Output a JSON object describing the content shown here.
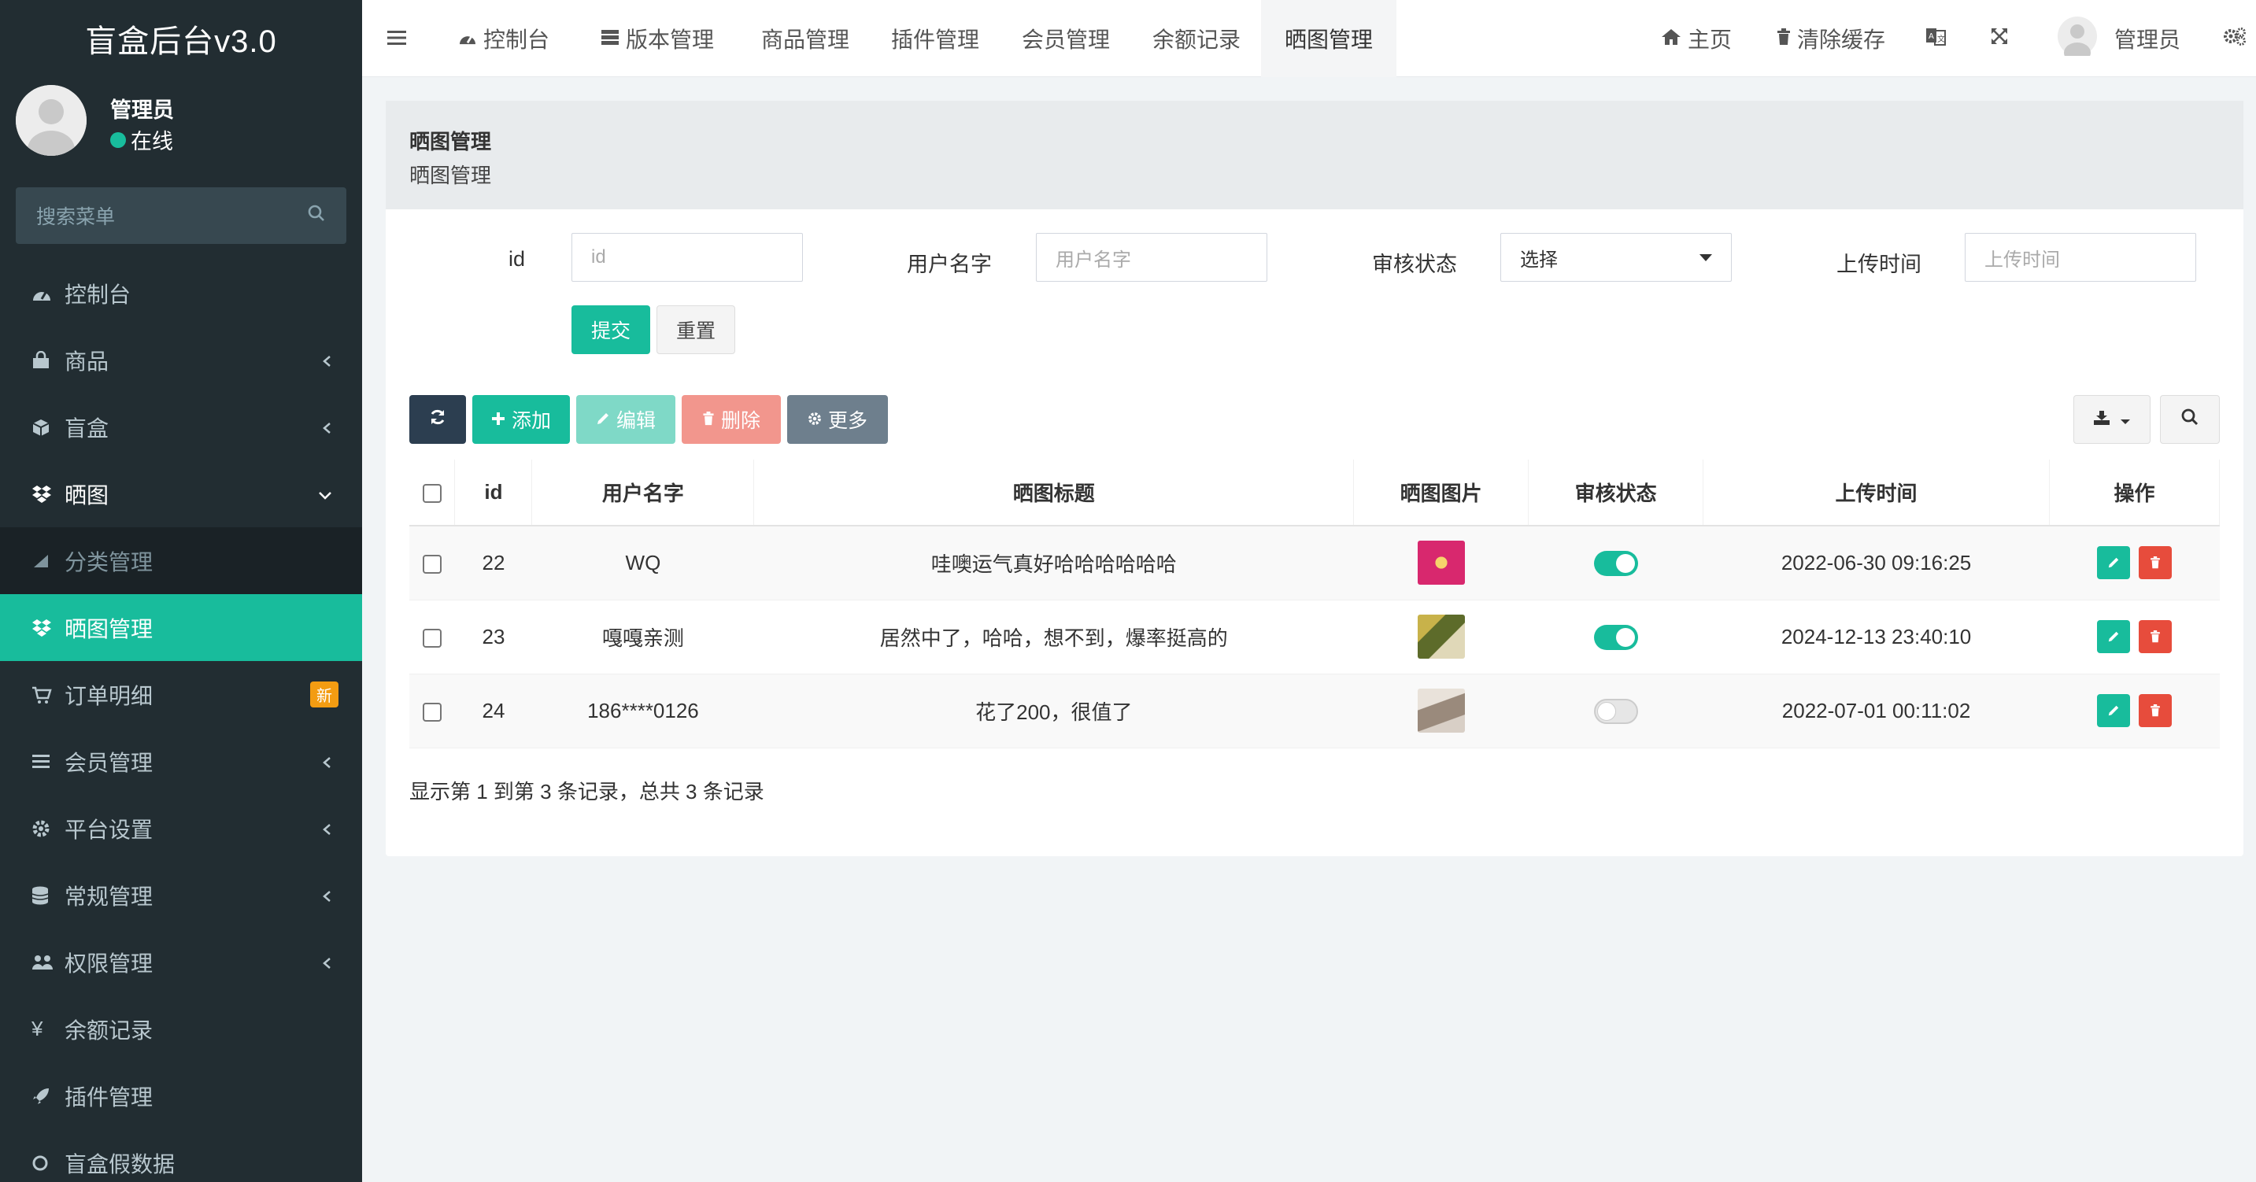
{
  "app": {
    "brand": "盲盒后台v3.0",
    "accent": "#18bc9c",
    "sidebar_bg": "#222d32"
  },
  "user": {
    "name": "管理员",
    "status": "在线"
  },
  "sidebar": {
    "search_placeholder": "搜索菜单",
    "items": [
      {
        "label": "控制台",
        "icon": "dashboard-icon"
      },
      {
        "label": "商品",
        "icon": "shopping-bag-icon"
      },
      {
        "label": "盲盒",
        "icon": "box-icon"
      },
      {
        "label": "晒图",
        "icon": "dropbox-icon"
      },
      {
        "label": "分类管理",
        "icon": "circle-icon"
      },
      {
        "label": "晒图管理",
        "icon": "dropbox-icon"
      },
      {
        "label": "订单明细",
        "icon": "cart-icon",
        "badge": "新"
      },
      {
        "label": "会员管理",
        "icon": "list-icon"
      },
      {
        "label": "平台设置",
        "icon": "gear-icon"
      },
      {
        "label": "常规管理",
        "icon": "database-icon"
      },
      {
        "label": "权限管理",
        "icon": "users-icon"
      },
      {
        "label": "余额记录",
        "icon": "yen-icon"
      },
      {
        "label": "插件管理",
        "icon": "rocket-icon"
      },
      {
        "label": "盲盒假数据",
        "icon": "circle-outline-icon"
      }
    ]
  },
  "topnav": {
    "tabs": [
      "控制台",
      "版本管理",
      "商品管理",
      "插件管理",
      "会员管理",
      "余额记录",
      "晒图管理"
    ],
    "home": "主页",
    "clear_cache": "清除缓存",
    "admin": "管理员"
  },
  "page": {
    "title": "晒图管理",
    "subtitle": "晒图管理"
  },
  "filters": {
    "id_label": "id",
    "id_placeholder": "id",
    "username_label": "用户名字",
    "username_placeholder": "用户名字",
    "status_label": "审核状态",
    "status_selected": "选择",
    "time_label": "上传时间",
    "time_placeholder": "上传时间",
    "submit": "提交",
    "reset": "重置"
  },
  "toolbar": {
    "add": "添加",
    "edit": "编辑",
    "delete": "删除",
    "more": "更多"
  },
  "table": {
    "headers": [
      "id",
      "用户名字",
      "晒图标题",
      "晒图图片",
      "审核状态",
      "上传时间",
      "操作"
    ],
    "rows": [
      {
        "id": "22",
        "username": "WQ",
        "title": "哇噢运气真好哈哈哈哈哈哈",
        "status_on": true,
        "time": "2022-06-30 09:16:25",
        "thumb_color": "#d8286e"
      },
      {
        "id": "23",
        "username": "嘎嘎亲测",
        "title": "居然中了，哈哈，想不到，爆率挺高的",
        "status_on": true,
        "time": "2024-12-13 23:40:10",
        "thumb_color": "#8b9a3a"
      },
      {
        "id": "24",
        "username": "186****0126",
        "title": "花了200，很值了",
        "status_on": false,
        "time": "2022-07-01 00:11:02",
        "thumb_color": "#b8a89a"
      }
    ]
  },
  "footer": {
    "summary": "显示第 1 到第 3 条记录，总共 3 条记录"
  }
}
